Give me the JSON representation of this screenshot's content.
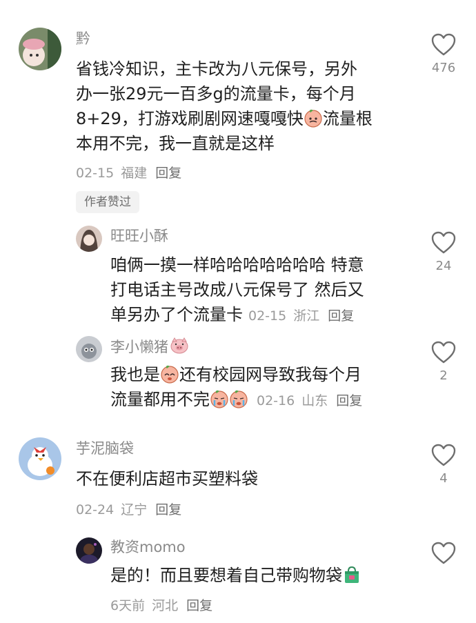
{
  "comments": [
    {
      "user": "黔",
      "lines": [
        "省钱冷知识，主卡改为八元保号，另外",
        "办一张29元一百多g的流量卡，每个月",
        "8+29，打游戏刷剧网速嘎嘎快",
        "流量根",
        "本用不完，我一直就是这样"
      ],
      "date": "02-15",
      "location": "福建",
      "reply": "回复",
      "likes": "476",
      "badge": "作者赞过"
    },
    {
      "user": "旺旺小酥",
      "lines": [
        "咱俩一摸一样哈哈哈哈哈哈哈  特意",
        "打电话主号改成八元保号了  然后又",
        "单另办了个流量卡"
      ],
      "date": "02-15",
      "location": "浙江",
      "reply": "回复",
      "likes": "24"
    },
    {
      "user": "李小懒猪",
      "lines": [
        "我也是",
        "还有校园网导致我每个月",
        "流量都用不完"
      ],
      "date": "02-16",
      "location": "山东",
      "reply": "回复",
      "likes": "2"
    },
    {
      "user": "芋泥脑袋",
      "lines": [
        "不在便利店超市买塑料袋"
      ],
      "date": "02-24",
      "location": "辽宁",
      "reply": "回复",
      "likes": "4"
    },
    {
      "user": "教资momo",
      "lines": [
        "是的！而且要想着自己带购物袋"
      ],
      "date": "6天前",
      "location": "河北",
      "reply": "回复",
      "likes": ""
    }
  ],
  "icons": {
    "heart": "heart-outline-icon",
    "peach_emoji": "peach-face-emoji",
    "crying_emoji": "peach-crying-emoji",
    "pig_emoji": "pig-face-emoji",
    "bag_emoji": "shopping-bag-emoji"
  },
  "colors": {
    "text": "#1f1f1f",
    "muted": "#8a8a8a",
    "badge_bg": "#f2f2f2"
  }
}
